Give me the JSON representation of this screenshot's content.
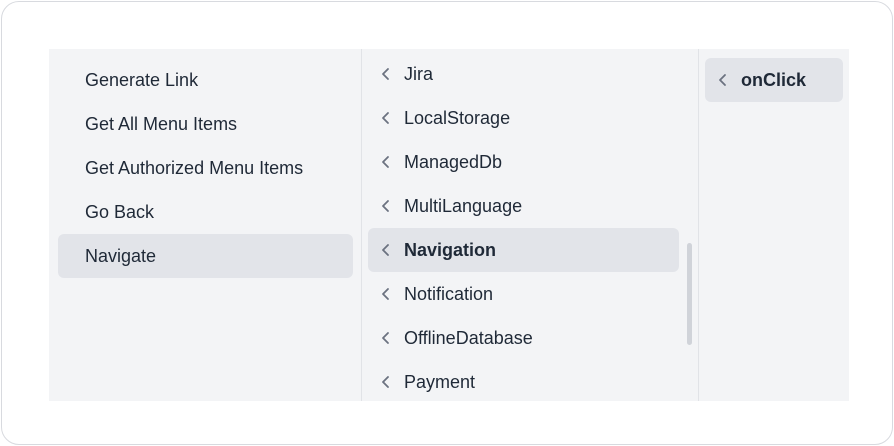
{
  "column1": {
    "items": [
      {
        "label": "Generate Link"
      },
      {
        "label": "Get All Menu Items"
      },
      {
        "label": "Get Authorized Menu Items"
      },
      {
        "label": "Go Back"
      },
      {
        "label": "Navigate"
      }
    ],
    "selected": "Navigate"
  },
  "column2": {
    "items": [
      {
        "label": "Jira",
        "icon": "chevron-left-icon"
      },
      {
        "label": "LocalStorage",
        "icon": "chevron-left-icon"
      },
      {
        "label": "ManagedDb",
        "icon": "chevron-left-icon"
      },
      {
        "label": "MultiLanguage",
        "icon": "chevron-left-icon"
      },
      {
        "label": "Navigation",
        "icon": "chevron-left-icon"
      },
      {
        "label": "Notification",
        "icon": "chevron-left-icon"
      },
      {
        "label": "OfflineDatabase",
        "icon": "chevron-left-icon"
      },
      {
        "label": "Payment",
        "icon": "chevron-left-icon"
      }
    ],
    "selected": "Navigation"
  },
  "column3": {
    "items": [
      {
        "label": "onClick",
        "icon": "chevron-left-icon"
      }
    ],
    "selected": "onClick"
  },
  "colors": {
    "panel_bg": "#f3f4f6",
    "selected_bg": "#e2e4e9",
    "text": "#1f2937",
    "chevron": "#6b7280"
  }
}
